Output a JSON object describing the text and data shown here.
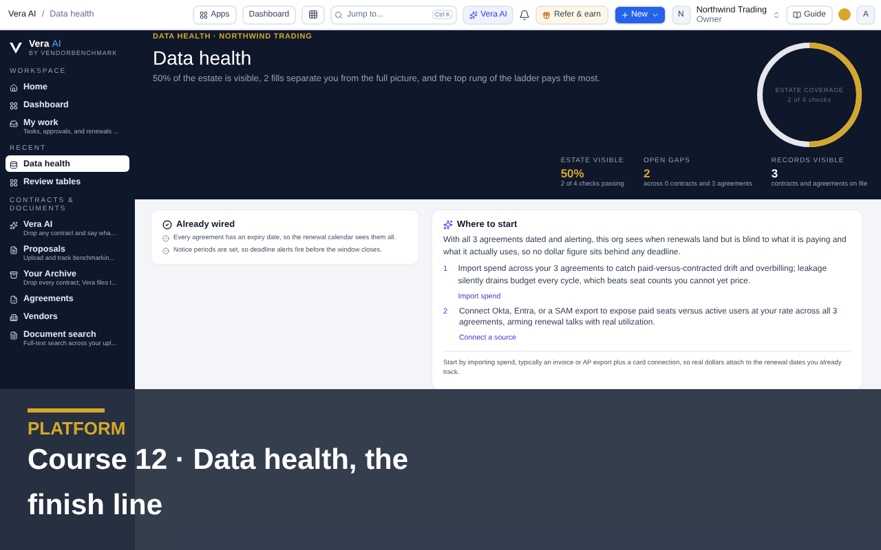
{
  "topbar": {
    "breadcrumb": [
      "Vera AI",
      "/",
      "Data health"
    ],
    "apps_label": "Apps",
    "dashboard_label": "Dashboard",
    "search": {
      "placeholder": "Jump to...",
      "shortcut": "Ctrl K"
    },
    "assistant_label": "Vera AI",
    "refer_label": "Refer & earn",
    "new_label": "New",
    "org": {
      "initial": "N",
      "name": "Northwind Trading",
      "role": "Owner"
    },
    "guide_label": "Guide",
    "avatar": "A"
  },
  "sidebar": {
    "brand": "Vera",
    "brand_accent": "AI",
    "byline": "BY VENDORBENCHMARK",
    "sections": [
      {
        "title": "WORKSPACE",
        "items": [
          {
            "label": "Home",
            "selected": false
          },
          {
            "label": "Dashboard",
            "selected": false
          },
          {
            "label": "My work",
            "sub": "Tasks, approvals, and renewals ...",
            "selected": false
          }
        ]
      },
      {
        "title": "RECENT",
        "items": [
          {
            "label": "Data health",
            "selected": true
          },
          {
            "label": "Review tables",
            "selected": false
          }
        ]
      },
      {
        "title": "CONTRACTS & DOCUMENTS",
        "items": [
          {
            "label": "Vera AI",
            "sub": "Drop any contract and say wha...",
            "selected": false
          },
          {
            "label": "Proposals",
            "sub": "Upload and track benchmarkin...",
            "selected": false
          },
          {
            "label": "Your Archive",
            "sub": "Drop every contract; Vera files t...",
            "selected": false
          },
          {
            "label": "Agreements",
            "selected": false
          },
          {
            "label": "Vendors",
            "selected": false
          },
          {
            "label": "Document search",
            "sub": "Full-text search across your upl...",
            "selected": false
          }
        ]
      }
    ]
  },
  "hero": {
    "eyebrow": "DATA HEALTH · NORTHWIND TRADING",
    "title": "Data health",
    "summary": "50% of the estate is visible, 2 fills separate you from the full picture, and the top rung of the ladder pays the most.",
    "coverage": {
      "label": "ESTATE COVERAGE",
      "detail": "2 of 4 checks",
      "level": 0.5
    },
    "stats": [
      {
        "label": "ESTATE VISIBLE",
        "value": "50%",
        "note": "2 of 4 checks passing",
        "color": "#d4a72c"
      },
      {
        "label": "OPEN GAPS",
        "value": "2",
        "note": "across 0 contracts and 3 agreements",
        "color": "#d4a72c"
      },
      {
        "label": "RECORDS VISIBLE",
        "value": "3",
        "note": "contracts and agreements on file",
        "color": "#ffffff"
      }
    ]
  },
  "wired": {
    "title": "Already wired",
    "items": [
      "Every agreement has an expiry date, so the renewal calendar sees them all.",
      "Notice periods are set, so deadline alerts fire before the window closes."
    ]
  },
  "start": {
    "title": "Where to start",
    "intro": "With all 3 agreements dated and alerting, this org sees when renewals land but is blind to what it is paying and what it actually uses, so no dollar figure sits behind any deadline.",
    "steps": [
      {
        "number": "1",
        "text": "Import spend across your 3 agreements to catch paid-versus-contracted drift and overbilling; leakage silently drains budget every cycle, which beats seat counts you cannot yet price.",
        "link": "Import spend"
      },
      {
        "number": "2",
        "text": "Connect Okta, Entra, or a SAM export to expose paid seats versus active users at your rate across all 3 agreements, arming renewal talks with real utilization.",
        "link": "Connect a source"
      }
    ],
    "footer": "Start by importing spend, typically an invoice or AP export plus a card connection, so real dollars attach to the renewal dates you already track."
  },
  "banner": {
    "eyebrow": "PLATFORM",
    "title": "Course 12 · Data health, the finish line"
  }
}
